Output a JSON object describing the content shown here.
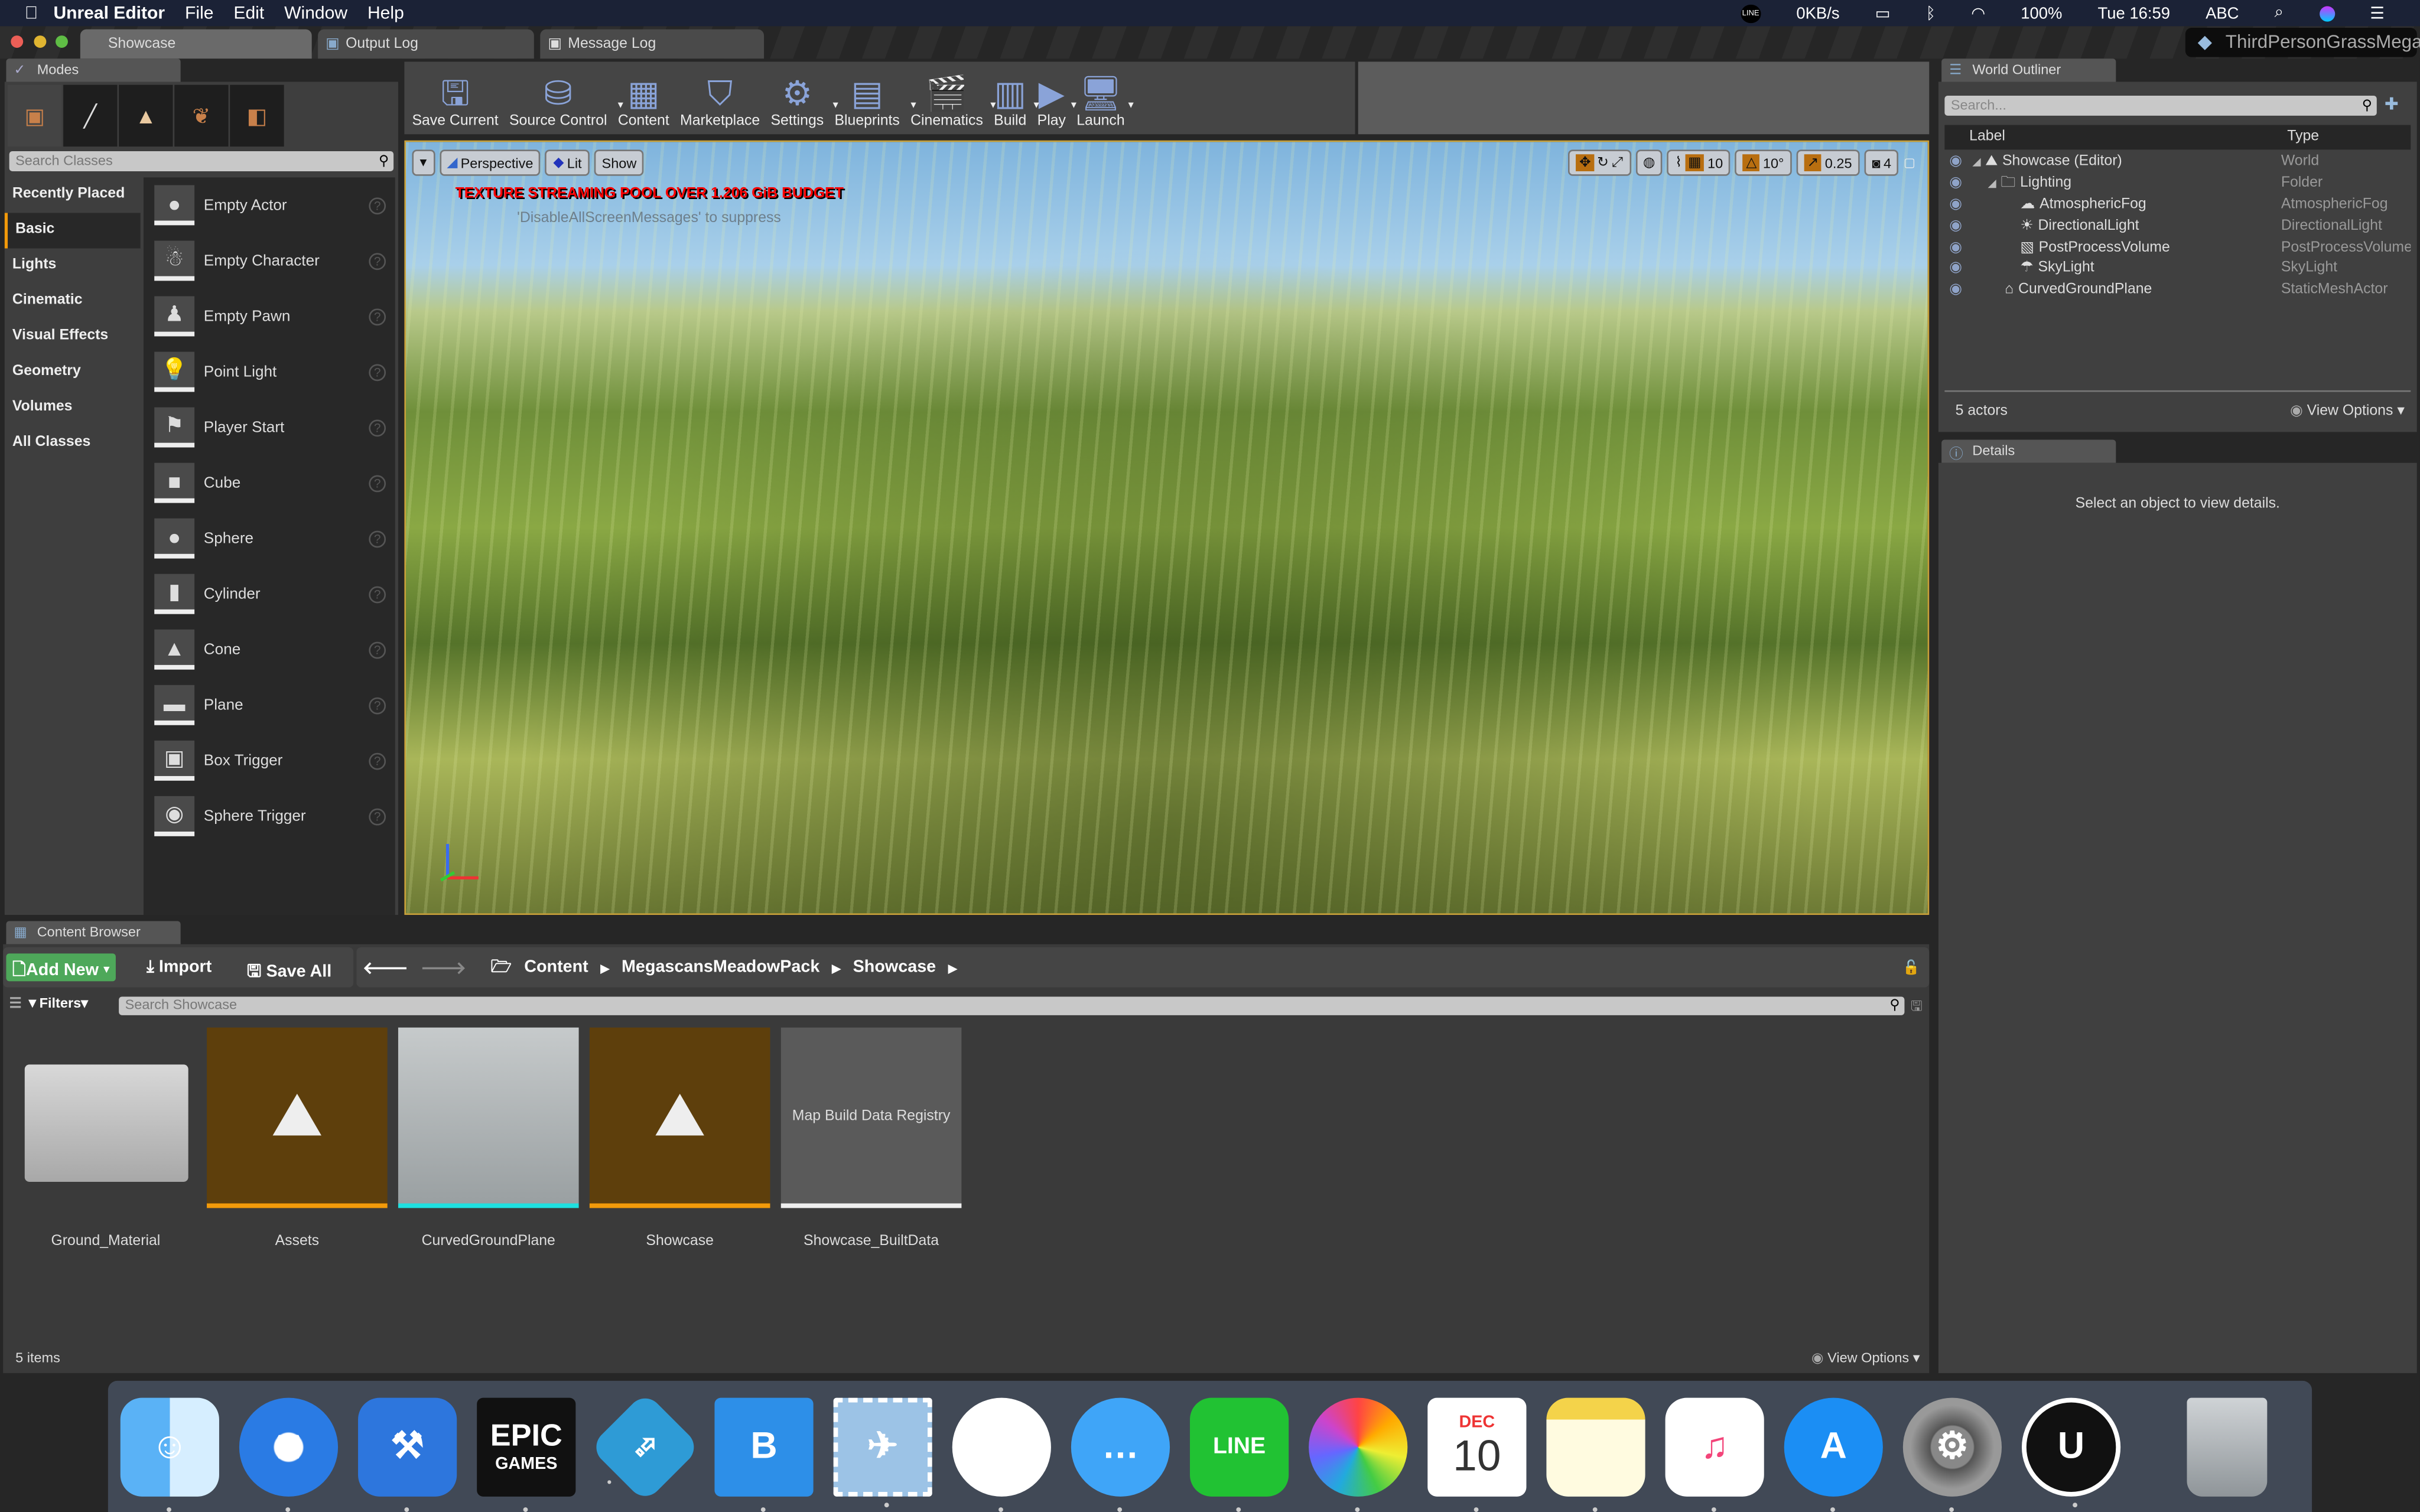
{
  "menubar": {
    "app": "Unreal Editor",
    "items": [
      "File",
      "Edit",
      "Window",
      "Help"
    ],
    "net_speed": "0KB/s",
    "battery": "100%",
    "clock": "Tue 16:59",
    "input": "ABC",
    "line_badge": "LINE"
  },
  "window": {
    "tabs": [
      "Showcase",
      "Output Log",
      "Message Log"
    ],
    "project": "ThirdPersonGrassMega"
  },
  "modes": {
    "title": "Modes",
    "search_placeholder": "Search Classes",
    "categories": [
      "Recently Placed",
      "Basic",
      "Lights",
      "Cinematic",
      "Visual Effects",
      "Geometry",
      "Volumes",
      "All Classes"
    ],
    "selected_category": "Basic",
    "items": [
      "Empty Actor",
      "Empty Character",
      "Empty Pawn",
      "Point Light",
      "Player Start",
      "Cube",
      "Sphere",
      "Cylinder",
      "Cone",
      "Plane",
      "Box Trigger",
      "Sphere Trigger"
    ]
  },
  "toolbar": [
    "Save Current",
    "Source Control",
    "Content",
    "Marketplace",
    "Settings",
    "Blueprints",
    "Cinematics",
    "Build",
    "Play",
    "Launch"
  ],
  "viewport": {
    "perspective": "Perspective",
    "lit": "Lit",
    "show": "Show",
    "grid_snap": "10",
    "rot_snap": "10°",
    "scale_snap": "0.25",
    "camera_speed": "4",
    "warning": "TEXTURE STREAMING POOL OVER 1.206 GiB BUDGET",
    "hint": "'DisableAllScreenMessages' to suppress"
  },
  "outliner": {
    "title": "World Outliner",
    "search_placeholder": "Search...",
    "col_label": "Label",
    "col_type": "Type",
    "rows": [
      {
        "label": "Showcase (Editor)",
        "type": "World"
      },
      {
        "label": "Lighting",
        "type": "Folder"
      },
      {
        "label": "AtmosphericFog",
        "type": "AtmosphericFog"
      },
      {
        "label": "DirectionalLight",
        "type": "DirectionalLight"
      },
      {
        "label": "PostProcessVolume",
        "type": "PostProcessVolume"
      },
      {
        "label": "SkyLight",
        "type": "SkyLight"
      },
      {
        "label": "CurvedGroundPlane",
        "type": "StaticMeshActor"
      }
    ],
    "count": "5 actors",
    "view_options": "View Options"
  },
  "details": {
    "title": "Details",
    "empty": "Select an object to view details."
  },
  "content_browser": {
    "title": "Content Browser",
    "add_new": "Add New",
    "import": "Import",
    "save_all": "Save All",
    "path": [
      "Content",
      "MegascansMeadowPack",
      "Showcase"
    ],
    "filters": "Filters",
    "search_placeholder": "Search Showcase",
    "assets": [
      {
        "name": "Ground_Material",
        "kind": "folder"
      },
      {
        "name": "Assets",
        "kind": "level"
      },
      {
        "name": "CurvedGroundPlane",
        "kind": "mesh"
      },
      {
        "name": "Showcase",
        "kind": "level"
      },
      {
        "name": "Showcase_BuiltData",
        "kind": "registry",
        "thumb_text": "Map Build Data Registry"
      }
    ],
    "count": "5 items",
    "view_options": "View Options"
  },
  "dock": {
    "apps": [
      "finder-icon",
      "safari-icon",
      "xcode-icon",
      "epic-games-icon",
      "remote-desktop-icon",
      "bezel-icon",
      "mail-stamp-icon",
      "slack-icon",
      "messages-icon",
      "line-icon",
      "photos-icon",
      "calendar-icon",
      "notes-icon",
      "music-icon",
      "app-store-icon",
      "system-preferences-icon",
      "unreal-icon",
      "trash-icon"
    ],
    "epic_line1": "EPIC",
    "epic_line2": "GAMES",
    "line_label": "LINE",
    "cal_month": "DEC",
    "cal_day": "10"
  },
  "colors": {
    "accent": "#f29a0a",
    "add_new": "#4ea85a",
    "menubar": "#1b2236",
    "warning": "#ff0000"
  }
}
